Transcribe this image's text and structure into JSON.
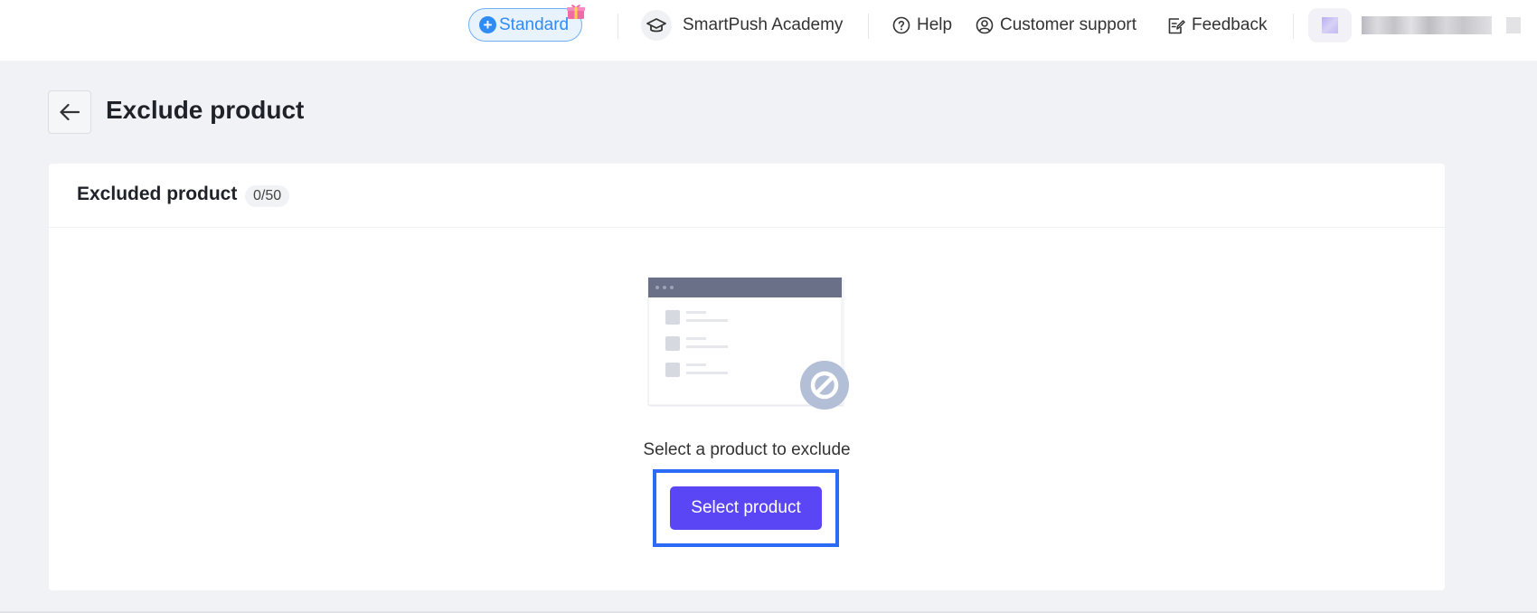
{
  "topbar": {
    "plan_label": "Standard",
    "academy_label": "SmartPush Academy",
    "help_label": "Help",
    "support_label": "Customer support",
    "feedback_label": "Feedback",
    "accent_color": "#2f8cf4",
    "icons": {
      "plan": "plus-circle-icon",
      "gift": "gift-icon",
      "academy": "graduation-cap-icon",
      "help": "question-circle-icon",
      "support": "user-circle-icon",
      "feedback": "edit-document-icon"
    }
  },
  "header": {
    "title": "Exclude product",
    "back_icon": "arrow-left-icon"
  },
  "card": {
    "title": "Excluded product",
    "count": "0/50",
    "empty_text": "Select a product to exclude",
    "button_label": "Select product",
    "button_color": "#5b46f5",
    "illustration_icon": "blocked-list-icon"
  }
}
